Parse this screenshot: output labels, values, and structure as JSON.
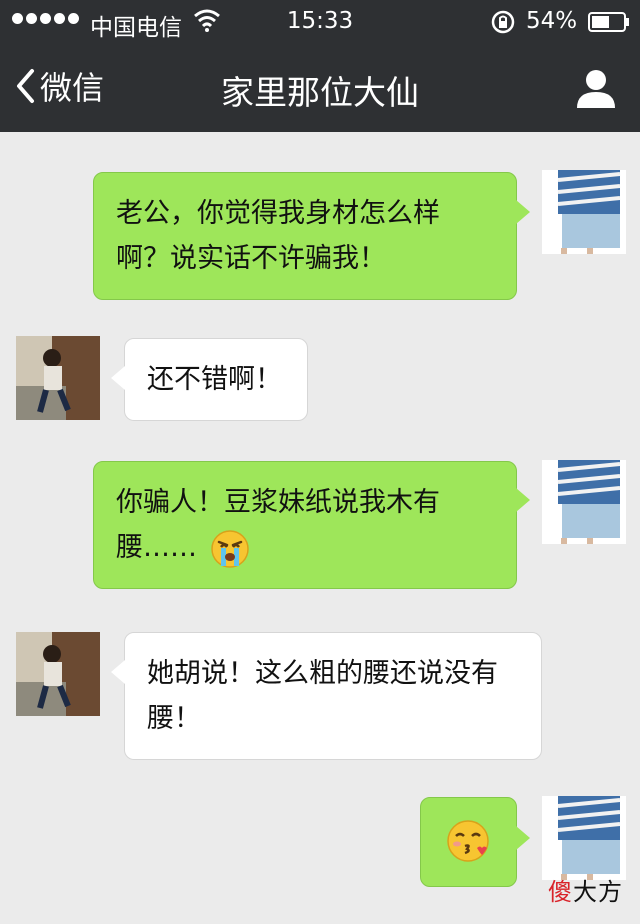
{
  "status_bar": {
    "carrier": "中国电信",
    "time": "15:33",
    "battery": "54%"
  },
  "nav": {
    "back_label": "微信",
    "title": "家里那位大仙"
  },
  "messages": [
    {
      "side": "sent",
      "text_line1": "老公，你觉得我身材怎么样",
      "text_line2": "啊？说实话不许骗我！"
    },
    {
      "side": "received",
      "text": "还不错啊！"
    },
    {
      "side": "sent",
      "text_line1": "你骗人！豆浆妹纸说我木有",
      "text_line2": "腰……",
      "emoji": "crying-emoji"
    },
    {
      "side": "received",
      "text_line1": "她胡说！这么粗的腰还说没有",
      "text_line2": "腰！"
    },
    {
      "side": "sent",
      "emoji": "kissing-emoji"
    }
  ],
  "watermark": {
    "char1": "傻",
    "rest": "大方"
  },
  "colors": {
    "nav_bg": "#2e3033",
    "sent_bubble": "#9ee65a",
    "received_bubble": "#ffffff",
    "chat_bg": "#ebebeb"
  }
}
